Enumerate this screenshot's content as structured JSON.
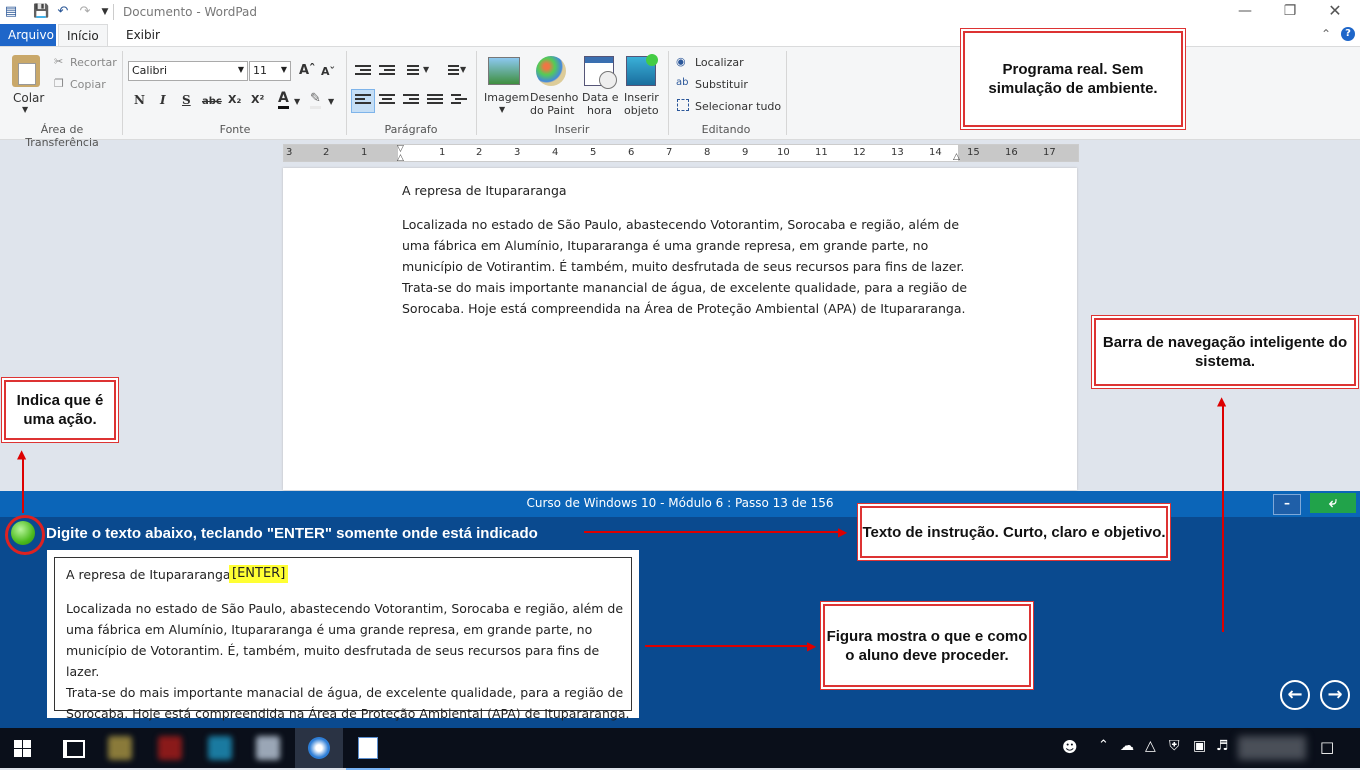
{
  "window": {
    "title": "Documento - WordPad"
  },
  "tabs": [
    "Arquivo",
    "Início",
    "Exibir"
  ],
  "ribbon": {
    "clipboard": {
      "paste": "Colar",
      "cut": "Recortar",
      "copy": "Copiar",
      "label": "Área de Transferência"
    },
    "font": {
      "family": "Calibri",
      "size": "11",
      "label": "Fonte",
      "bold": "N",
      "italic": "I",
      "underline": "S",
      "strike": "abc"
    },
    "paragraph": {
      "label": "Parágrafo"
    },
    "insert": {
      "image": "Imagem",
      "paint1": "Desenho",
      "paint2": "do Paint",
      "date1": "Data e",
      "date2": "hora",
      "obj1": "Inserir",
      "obj2": "objeto",
      "label": "Inserir"
    },
    "editing": {
      "find": "Localizar",
      "replace": "Substituir",
      "select_all": "Selecionar tudo",
      "label": "Editando"
    }
  },
  "ruler": [
    "3",
    "2",
    "1",
    "1",
    "2",
    "3",
    "4",
    "5",
    "6",
    "7",
    "8",
    "9",
    "10",
    "11",
    "12",
    "13",
    "14",
    "15",
    "16",
    "17"
  ],
  "document": {
    "heading": "A represa de Itupararanga",
    "body_lines": [
      "Localizada no estado de São Paulo, abastecendo Votorantim, Sorocaba e região, além de",
      "uma fábrica em Alumínio, Itupararanga é uma grande represa, em grande parte, no",
      "município de Votirantim. É também, muito desfrutada de seus recursos para fins de lazer.",
      "Trata-se do mais importante manancial de água, de excelente qualidade, para a região de",
      "Sorocaba. Hoje está compreendida na Área de Proteção Ambiental (APA) de Itupararanga."
    ]
  },
  "course_nav": {
    "status": "Curso de Windows 10 - Módulo 6 : Passo 13 de 156",
    "minimize": "–"
  },
  "instruction": "Digite o texto abaixo, teclando \"ENTER\" somente onde está indicado",
  "example": {
    "heading": "A represa de Itupararanga",
    "enter_tag": "[ENTER]",
    "body_lines": [
      "Localizada no estado de São Paulo, abastecendo Votorantim, Sorocaba e região, além de",
      "uma fábrica em Alumínio, Itupararanga é uma grande represa, em grande parte, no",
      "município de Votorantim. É, também, muito desfrutada de seus recursos para fins de lazer.",
      "Trata-se do mais importante manacial de água, de excelente qualidade, para a região de",
      "Sorocaba. Hoje está compreendida na Área de Proteção Ambiental (APA) de Itupararanga."
    ]
  },
  "callouts": {
    "real_program": "Programa real. Sem simulação de ambiente.",
    "smart_nav": "Barra de navegação inteligente do sistema.",
    "action": "Indica que é uma ação.",
    "instruction_text": "Texto de instrução. Curto, claro e objetivo.",
    "figure": "Figura mostra o que e como o aluno deve proceder."
  },
  "colors": {
    "accent": "#2b579a",
    "panel": "#0a4a8f",
    "navbar": "#0b65b8",
    "callout_border": "#d33333",
    "highlight": "#ffff33"
  }
}
